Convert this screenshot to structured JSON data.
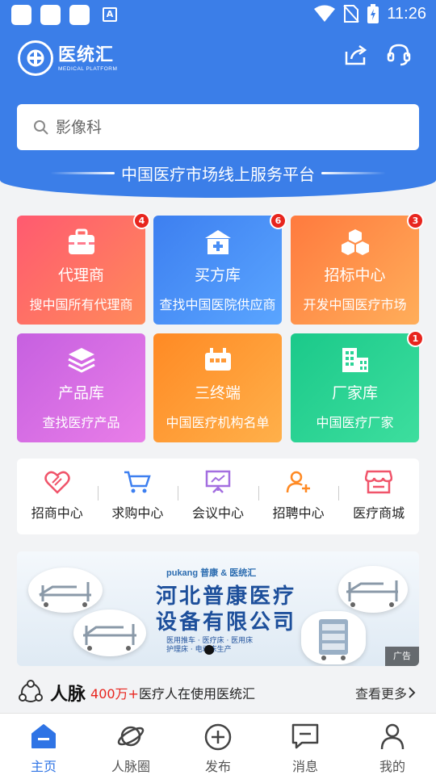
{
  "status_bar": {
    "time": "11:26"
  },
  "header": {
    "logo_title": "医统汇",
    "logo_subtitle": "MEDICAL PLATFORM"
  },
  "search": {
    "placeholder": "影像科"
  },
  "slogan": "中国医疗市场线上服务平台",
  "tiles": [
    {
      "title": "代理商",
      "subtitle": "搜中国所有代理商",
      "badge": "4",
      "icon": "toolbox-icon",
      "colors": [
        "#ff5a70",
        "#ff8a5a"
      ]
    },
    {
      "title": "买方库",
      "subtitle": "查找中国医院供应商",
      "badge": "6",
      "icon": "hospital-icon",
      "colors": [
        "#3d7ff0",
        "#5aa5ff"
      ]
    },
    {
      "title": "招标中心",
      "subtitle": "开发中国医疗市场",
      "badge": "3",
      "icon": "cubes-icon",
      "colors": [
        "#ff7a3e",
        "#ffae5a"
      ]
    },
    {
      "title": "产品库",
      "subtitle": "查找医疗产品",
      "badge": "",
      "icon": "layers-icon",
      "colors": [
        "#c660e0",
        "#e97ee8"
      ]
    },
    {
      "title": "三终端",
      "subtitle": "中国医疗机构名单",
      "badge": "",
      "icon": "terminal-icon",
      "colors": [
        "#ff8a24",
        "#ffb04a"
      ]
    },
    {
      "title": "厂家库",
      "subtitle": "中国医疗厂家",
      "badge": "1",
      "icon": "factory-icon",
      "colors": [
        "#1bc98a",
        "#3dde9e"
      ]
    }
  ],
  "quick_menu": [
    {
      "label": "招商中心",
      "icon": "handshake-icon",
      "color": "#f0546a"
    },
    {
      "label": "求购中心",
      "icon": "cart-icon",
      "color": "#3d7ff0"
    },
    {
      "label": "会议中心",
      "icon": "presentation-icon",
      "color": "#a36ee0"
    },
    {
      "label": "招聘中心",
      "icon": "add-user-icon",
      "color": "#ff8a24"
    },
    {
      "label": "医疗商城",
      "icon": "store-icon",
      "color": "#f0546a"
    }
  ],
  "banner": {
    "brand": "pukang 普康 & 医统汇",
    "company_line1": "河北普康医疗",
    "company_line2": "设备有限公司",
    "tag_line1": "医用推车 · 医疗床 · 医用床",
    "tag_line2": "护理床 · 电动床生产",
    "ad_label": "广告"
  },
  "network": {
    "title": "人脉",
    "count": "400万+",
    "desc": "医疗人在使用医统汇",
    "more": "查看更多"
  },
  "tabbar": [
    {
      "label": "主页",
      "icon": "home-icon",
      "active": true
    },
    {
      "label": "人脉圈",
      "icon": "planet-icon",
      "active": false
    },
    {
      "label": "发布",
      "icon": "plus-circle-icon",
      "active": false
    },
    {
      "label": "消息",
      "icon": "message-icon",
      "active": false
    },
    {
      "label": "我的",
      "icon": "user-icon",
      "active": false
    }
  ],
  "colors": {
    "primary": "#3b7ee8",
    "active_tab": "#2f74e5",
    "badge": "#e8251e"
  }
}
